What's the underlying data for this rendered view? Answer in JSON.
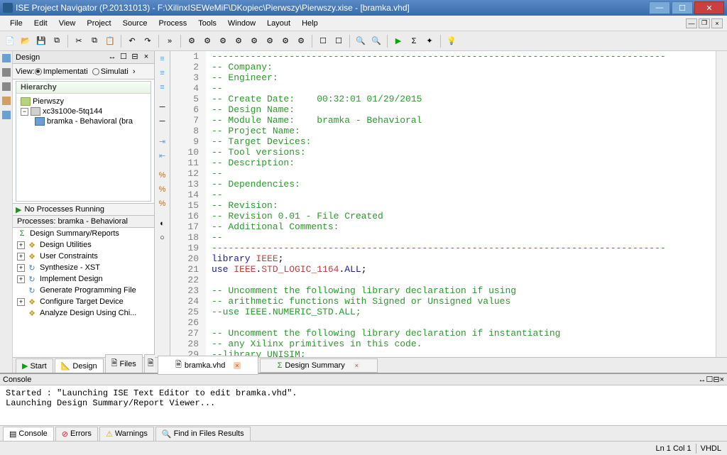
{
  "title": "ISE Project Navigator (P.20131013) - F:\\XilinxISEWeMiF\\DKopiec\\Pierwszy\\Pierwszy.xise - [bramka.vhd]",
  "menus": [
    "File",
    "Edit",
    "View",
    "Project",
    "Source",
    "Process",
    "Tools",
    "Window",
    "Layout",
    "Help"
  ],
  "design_panel": {
    "title": "Design",
    "view_label": "View:",
    "impl_label": "Implementati",
    "sim_label": "Simulati"
  },
  "hierarchy": {
    "title": "Hierarchy",
    "project": "Pierwszy",
    "chip": "xc3s100e-5tq144",
    "module": "bramka - Behavioral (bra"
  },
  "process_status": "No Processes Running",
  "processes": {
    "title": "Processes: bramka - Behavioral",
    "items": [
      {
        "icon": "summary",
        "label": "Design Summary/Reports"
      },
      {
        "icon": "util",
        "label": "Design Utilities"
      },
      {
        "icon": "constraint",
        "label": "User Constraints"
      },
      {
        "icon": "synth",
        "label": "Synthesize - XST"
      },
      {
        "icon": "impl",
        "label": "Implement Design"
      },
      {
        "icon": "prog",
        "label": "Generate Programming File"
      },
      {
        "icon": "target",
        "label": "Configure Target Device"
      },
      {
        "icon": "analyze",
        "label": "Analyze Design Using Chi..."
      }
    ]
  },
  "left_tabs": [
    "Start",
    "Design",
    "Files"
  ],
  "editor": {
    "tab_active": "bramka.vhd",
    "tab_inactive": "Design Summary",
    "lines": [
      {
        "n": 1,
        "cls": "comment",
        "text": "----------------------------------------------------------------------------------"
      },
      {
        "n": 2,
        "cls": "comment",
        "text": "-- Company: "
      },
      {
        "n": 3,
        "cls": "comment",
        "text": "-- Engineer: "
      },
      {
        "n": 4,
        "cls": "comment",
        "text": "-- "
      },
      {
        "n": 5,
        "cls": "comment",
        "text": "-- Create Date:    00:32:01 01/29/2015 "
      },
      {
        "n": 6,
        "cls": "comment",
        "text": "-- Design Name: "
      },
      {
        "n": 7,
        "cls": "comment",
        "text": "-- Module Name:    bramka - Behavioral "
      },
      {
        "n": 8,
        "cls": "comment",
        "text": "-- Project Name: "
      },
      {
        "n": 9,
        "cls": "comment",
        "text": "-- Target Devices: "
      },
      {
        "n": 10,
        "cls": "comment",
        "text": "-- Tool versions: "
      },
      {
        "n": 11,
        "cls": "comment",
        "text": "-- Description: "
      },
      {
        "n": 12,
        "cls": "comment",
        "text": "--"
      },
      {
        "n": 13,
        "cls": "comment",
        "text": "-- Dependencies: "
      },
      {
        "n": 14,
        "cls": "comment",
        "text": "--"
      },
      {
        "n": 15,
        "cls": "comment",
        "text": "-- Revision: "
      },
      {
        "n": 16,
        "cls": "comment",
        "text": "-- Revision 0.01 - File Created"
      },
      {
        "n": 17,
        "cls": "comment",
        "text": "-- Additional Comments: "
      },
      {
        "n": 18,
        "cls": "comment",
        "text": "--"
      },
      {
        "n": 19,
        "cls": "comment",
        "text": "----------------------------------------------------------------------------------"
      },
      {
        "n": 20,
        "cls": "code",
        "html": "<span class=\"keyword\">library</span> <span class=\"lib\">IEEE</span>;"
      },
      {
        "n": 21,
        "cls": "code",
        "html": "<span class=\"keyword\">use</span> <span class=\"lib\">IEEE</span>.<span class=\"lib\">STD_LOGIC_1164</span>.<span class=\"keyword\">ALL</span>;"
      },
      {
        "n": 22,
        "cls": "",
        "text": ""
      },
      {
        "n": 23,
        "cls": "comment",
        "text": "-- Uncomment the following library declaration if using"
      },
      {
        "n": 24,
        "cls": "comment",
        "text": "-- arithmetic functions with Signed or Unsigned values"
      },
      {
        "n": 25,
        "cls": "comment",
        "text": "--use IEEE.NUMERIC_STD.ALL;"
      },
      {
        "n": 26,
        "cls": "",
        "text": ""
      },
      {
        "n": 27,
        "cls": "comment",
        "text": "-- Uncomment the following library declaration if instantiating"
      },
      {
        "n": 28,
        "cls": "comment",
        "text": "-- any Xilinx primitives in this code."
      },
      {
        "n": 29,
        "cls": "comment",
        "text": "--library UNISIM;"
      }
    ]
  },
  "console": {
    "title": "Console",
    "lines": [
      "Started : \"Launching ISE Text Editor to edit bramka.vhd\".",
      "Launching Design Summary/Report Viewer..."
    ],
    "tabs": [
      "Console",
      "Errors",
      "Warnings",
      "Find in Files Results"
    ]
  },
  "status": {
    "pos": "Ln 1 Col 1",
    "lang": "VHDL"
  }
}
